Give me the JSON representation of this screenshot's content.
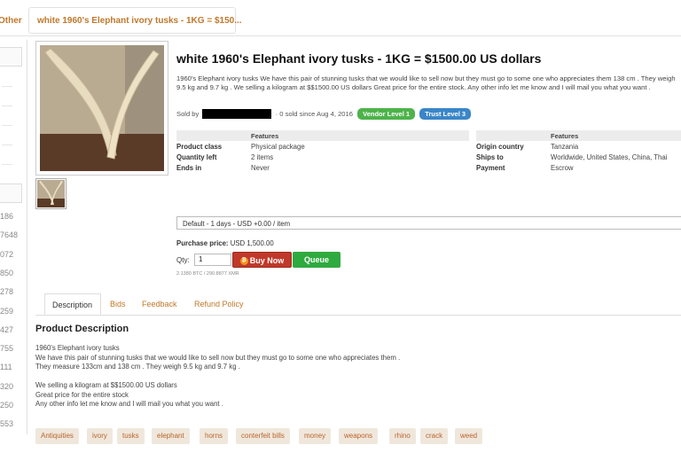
{
  "breadcrumb": {
    "other": "Other",
    "current": "white 1960's Elephant ivory tusks - 1KG = $150..."
  },
  "left_numbers": [
    "186",
    "7648",
    "072",
    "850",
    "278",
    "259",
    "427",
    "755",
    "111",
    "320",
    "250",
    "553"
  ],
  "listing": {
    "title": "white 1960's Elephant ivory tusks - 1KG = $1500.00 US dollars",
    "short_desc": "1960's Elephant ivory tusks We have this pair of stunning tusks that we would like to sell now but they must go to some one who appreciates them 138 cm . They weigh 9.5 kg and 9.7 kg . We selling a kilogram at $$1500.00 US dollars Great price for the entire stock. Any other info let me know and I will mail you what you want .",
    "sold_by": "Sold by",
    "sold_since": "· 0 sold since Aug 4, 2016",
    "vendor_badge": "Vendor Level 1",
    "trust_badge": "Trust Level 3"
  },
  "features": {
    "header_left": "Features",
    "header_right": "Features",
    "left_rows": [
      {
        "label": "Product class",
        "value": "Physical package"
      },
      {
        "label": "Quantity left",
        "value": "2 items"
      },
      {
        "label": "Ends in",
        "value": "Never"
      }
    ],
    "right_rows": [
      {
        "label": "Origin country",
        "value": "Tanzania"
      },
      {
        "label": "Ships to",
        "value": "Worldwide, United States, China, Thai"
      },
      {
        "label": "Payment",
        "value": "Escrow"
      }
    ]
  },
  "purchase": {
    "shipping_option": "Default - 1 days - USD +0.00 / item",
    "price_label": "Purchase price:",
    "price_value": "USD 1,500.00",
    "qty_label": "Qty:",
    "qty_value": "1",
    "buy_label": "Buy Now",
    "queue_label": "Queue",
    "btc_line": "2.1380 BTC / 290.8877 XMR"
  },
  "tabs": [
    "Description",
    "Bids",
    "Feedback",
    "Refund Policy"
  ],
  "product_description": {
    "heading": "Product Description",
    "lines": [
      "1960's Elephant ivory tusks",
      "We have this pair of stunning tusks that we would like to sell now but they must go to some one who appreciates them .",
      "They measure 133cm and 138 cm . They weigh 9.5 kg and 9.7 kg .",
      "",
      "We selling a kilogram at $$1500.00 US dollars",
      "Great price for the entire stock",
      "Any other info let me know and I will mail you what you want ."
    ]
  },
  "tags": [
    "Antiquities",
    "ivory",
    "tusks",
    "elephant",
    "horns",
    "conterfeit bills",
    "money",
    "weapons",
    "rhino",
    "crack",
    "weed"
  ],
  "colors": {
    "accent_orange": "#c0782a",
    "buy_red": "#c0392b",
    "queue_green": "#2faa3f",
    "vendor_green": "#4db34a",
    "trust_blue": "#3a86c8",
    "tag_bg": "#f0e7dc"
  }
}
